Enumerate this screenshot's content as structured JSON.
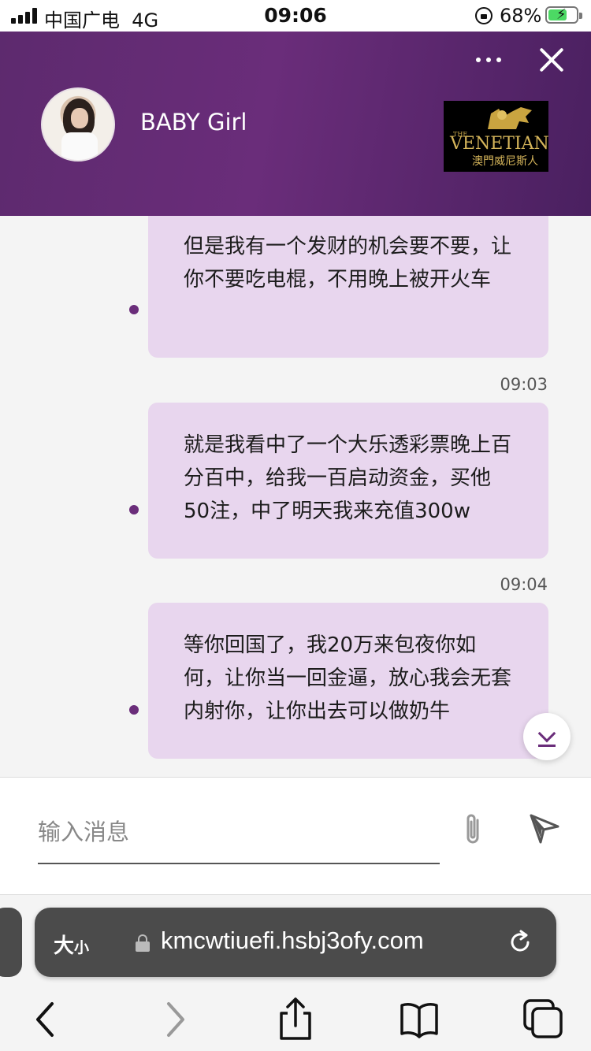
{
  "status_bar": {
    "carrier": "中国广电",
    "network": "4G",
    "time": "09:06",
    "battery_percent": "68%",
    "battery_level": 0.68
  },
  "header": {
    "contact_name": "BABY Girl",
    "logo": {
      "the": "THE",
      "name": "VENETIAN",
      "chinese": "澳門威尼斯人"
    }
  },
  "messages": [
    {
      "text": "但是我有一个发财的机会要不要，让你不要吃电棍，不用晚上被开火车",
      "time": "09:03"
    },
    {
      "text": "就是我看中了一个大乐透彩票晚上百分百中，给我一百启动资金，买他50注，中了明天我来充值300w",
      "time": "09:04"
    },
    {
      "text": "等你回国了，我20万来包夜你如何，让你当一回金逼，放心我会无套内射你，让你出去可以做奶牛",
      "time": ""
    }
  ],
  "composer": {
    "placeholder": "输入消息"
  },
  "browser": {
    "text_size_big": "大",
    "text_size_small": "小",
    "url": "kmcwtiuefi.hsbj3ofy.com"
  },
  "colors": {
    "header": "#5d2a6e",
    "bubble": "#e8d6ee",
    "accent": "#6a2d7a"
  }
}
